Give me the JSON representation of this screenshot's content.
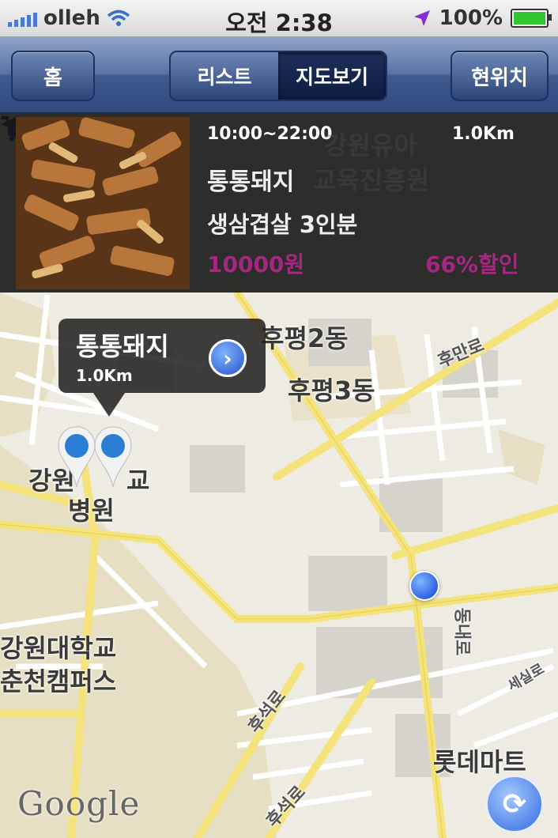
{
  "status_bar": {
    "carrier": "olleh",
    "time": "오전 2:38",
    "battery": "100%"
  },
  "nav": {
    "home_label": "홈",
    "segments": [
      {
        "label": "리스트",
        "active": false
      },
      {
        "label": "지도보기",
        "active": true
      }
    ],
    "location_label": "현위치"
  },
  "deal": {
    "hours": "10:00~22:00",
    "distance": "1.0Km",
    "store_name": "통통돼지",
    "menu": "생삼겹살 3인분",
    "price": "10000원",
    "discount": "66%할인",
    "accent_color": "#a5277f"
  },
  "map": {
    "callout": {
      "title": "통통돼지",
      "distance": "1.0Km",
      "detail_icon": "chevron-right-icon"
    },
    "labels": {
      "hupyeong2": "후평2동",
      "hupyeong3": "후평3동",
      "road_humanro": "후만로",
      "road_huseokro_mid": "후석로",
      "road_huseokro_bottom": "후석로",
      "road_dongnaero": "동내로",
      "road_sesilro": "세실로",
      "kangwon_top": "강원",
      "kangwon_right": "교",
      "hospital": "병원",
      "univ_line1": "강원대학교",
      "univ_line2": "춘천캠퍼스",
      "lotte_mart": "롯데마트",
      "kindergarten_line1": "강원유아",
      "kindergarten_line2": "교육진흥원"
    },
    "attribution": "Google",
    "refresh_icon": "refresh-icon"
  }
}
